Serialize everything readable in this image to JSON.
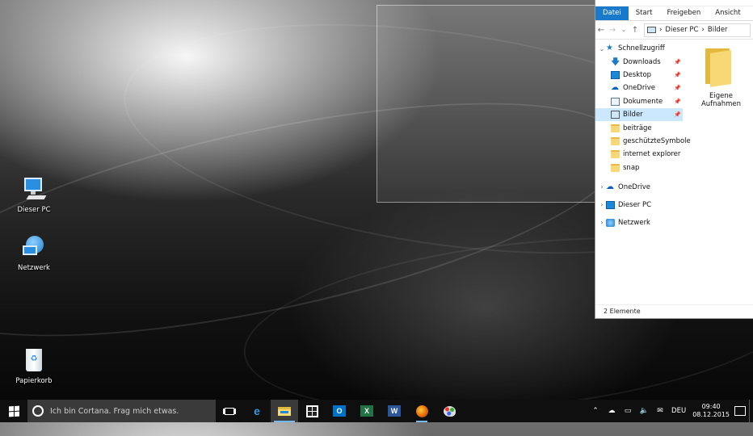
{
  "desktop": {
    "icons": [
      {
        "label": "Dieser PC",
        "icon": "computer-icon"
      },
      {
        "label": "Netzwerk",
        "icon": "network-icon"
      },
      {
        "label": "Papierkorb",
        "icon": "recycle-bin-icon"
      }
    ]
  },
  "explorer": {
    "ribbon_tabs": [
      "Datei",
      "Start",
      "Freigeben",
      "Ansicht"
    ],
    "breadcrumb": [
      "Dieser PC",
      "Bilder"
    ],
    "quick_access_label": "Schnellzugriff",
    "quick_access": [
      {
        "label": "Downloads",
        "icon": "download-arrow-icon",
        "pinned": true
      },
      {
        "label": "Desktop",
        "icon": "desktop-icon",
        "pinned": true
      },
      {
        "label": "OneDrive",
        "icon": "onedrive-cloud-icon",
        "pinned": true
      },
      {
        "label": "Dokumente",
        "icon": "documents-icon",
        "pinned": true
      },
      {
        "label": "Bilder",
        "icon": "pictures-icon",
        "pinned": true,
        "selected": true
      },
      {
        "label": "beiträge",
        "icon": "folder-icon"
      },
      {
        "label": "geschützteSymbole",
        "icon": "folder-icon"
      },
      {
        "label": "internet explorer",
        "icon": "folder-icon"
      },
      {
        "label": "snap",
        "icon": "folder-icon"
      }
    ],
    "roots": [
      {
        "label": "OneDrive",
        "icon": "onedrive-cloud-icon"
      },
      {
        "label": "Dieser PC",
        "icon": "computer-icon"
      },
      {
        "label": "Netzwerk",
        "icon": "network-icon"
      }
    ],
    "items": [
      {
        "label": "Eigene Aufnahmen",
        "icon": "folder-icon"
      }
    ],
    "status": "2 Elemente"
  },
  "taskbar": {
    "search_placeholder": "Ich bin Cortana. Frag mich etwas.",
    "apps": [
      {
        "name": "task-view",
        "icon": "task-view-icon"
      },
      {
        "name": "edge",
        "icon": "edge-icon"
      },
      {
        "name": "file-explorer",
        "icon": "file-explorer-icon",
        "active": true
      },
      {
        "name": "store",
        "icon": "store-icon"
      },
      {
        "name": "outlook",
        "icon": "outlook-icon"
      },
      {
        "name": "excel",
        "icon": "excel-icon"
      },
      {
        "name": "word",
        "icon": "word-icon"
      },
      {
        "name": "firefox",
        "icon": "firefox-icon",
        "running": true
      },
      {
        "name": "paint",
        "icon": "paint-icon"
      }
    ],
    "tray": {
      "language": "DEU",
      "time": "09:40",
      "date": "08.12.2015"
    }
  },
  "colors": {
    "accent": "#1979ca",
    "selection": "#cce8ff",
    "taskbar": "#0f0f0f",
    "search_box": "#3a3a3a",
    "folder": "#f8d775"
  }
}
